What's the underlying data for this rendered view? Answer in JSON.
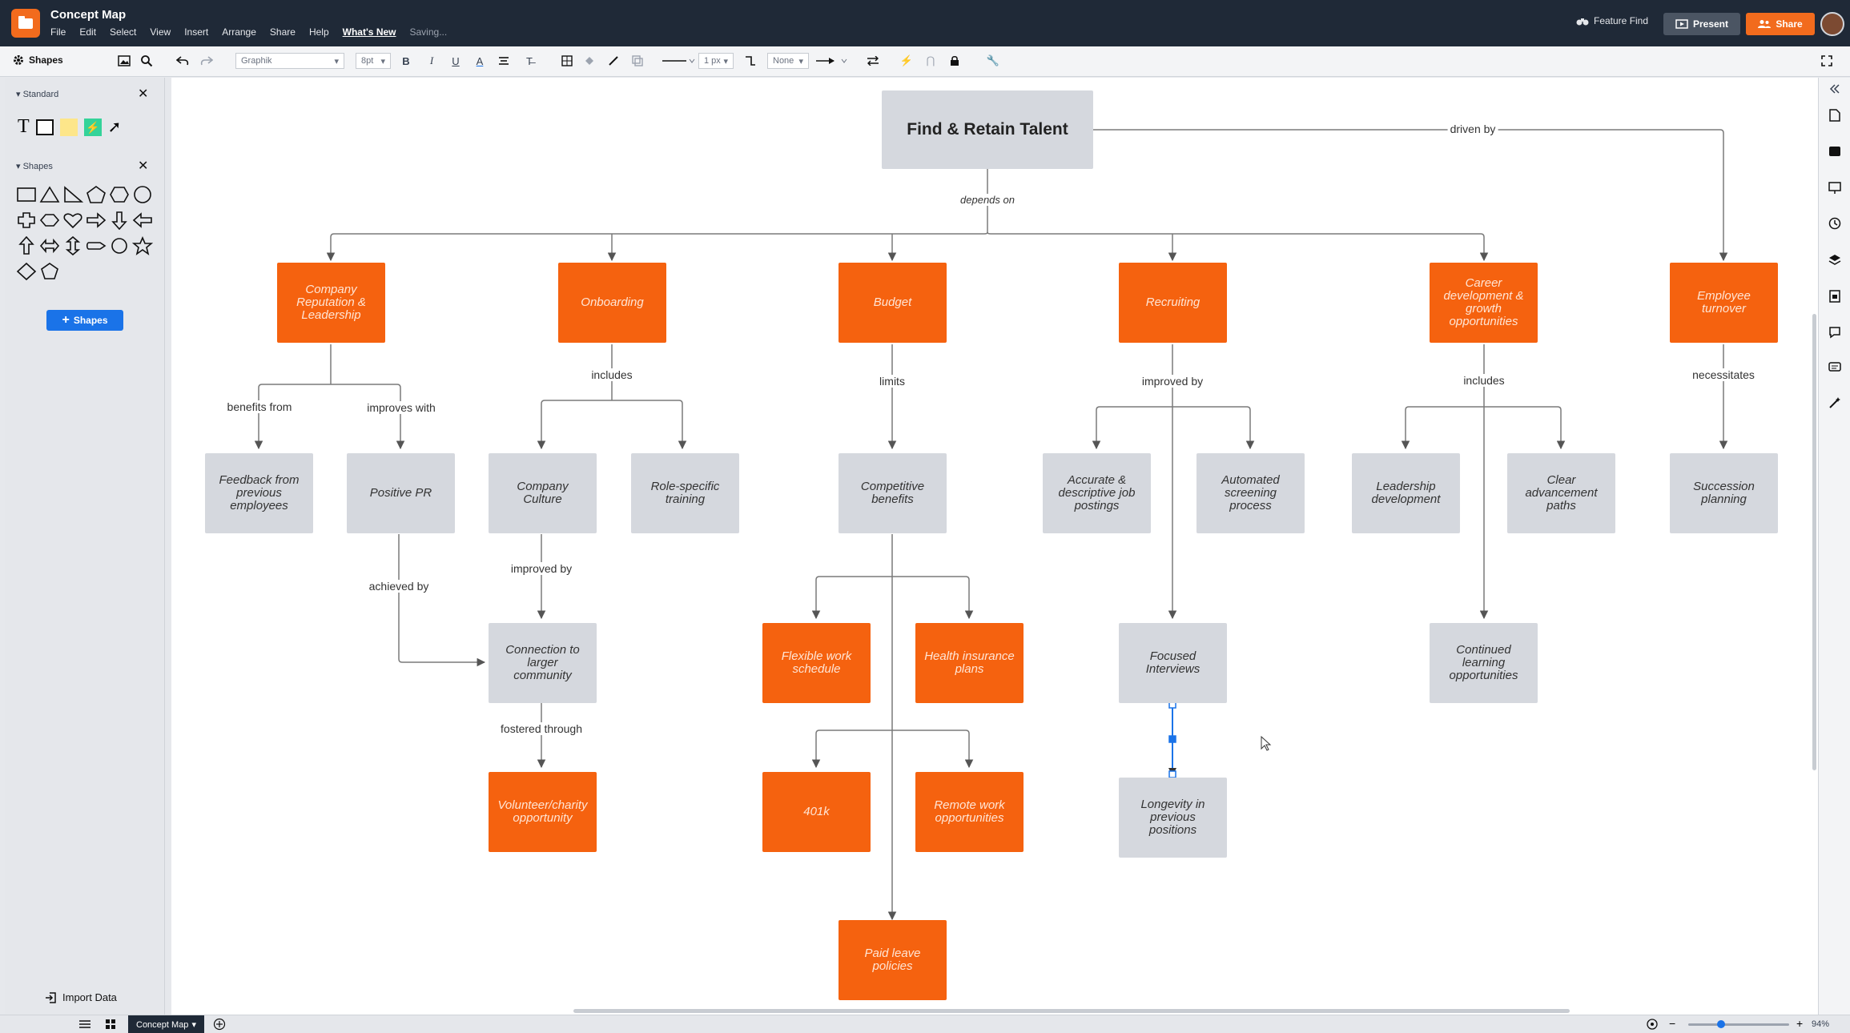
{
  "app": {
    "title": "Concept Map",
    "menus": [
      "File",
      "Edit",
      "Select",
      "View",
      "Insert",
      "Arrange",
      "Share",
      "Help",
      "What's New"
    ],
    "save_status": "Saving...",
    "feature_find": "Feature Find",
    "present": "Present",
    "share": "Share"
  },
  "toolbar": {
    "shapes_label": "Shapes",
    "font": "Graphik",
    "font_size": "8pt",
    "line_width": "1 px",
    "arrow_start": "None"
  },
  "left_panel": {
    "standard_header": "Standard",
    "shapes_header": "Shapes",
    "add_shapes_button": "Shapes",
    "import_data": "Import Data"
  },
  "diagram": {
    "root": "Find & Retain Talent",
    "root_edge_label": "depends on",
    "root_side_label": "driven by",
    "nodes": {
      "reputation": "Company Reputation & Leadership",
      "onboarding": "Onboarding",
      "budget": "Budget",
      "recruiting": "Recruiting",
      "career": "Career development & growth opportunities",
      "turnover": "Employee turnover",
      "feedback": "Feedback from previous employees",
      "positive_pr": "Positive PR",
      "culture": "Company Culture",
      "role_training": "Role-specific training",
      "competitive": "Competitive benefits",
      "accurate_postings": "Accurate & descriptive job postings",
      "screening": "Automated screening process",
      "leadership_dev": "Leadership development",
      "advancement": "Clear advancement paths",
      "succession": "Succession planning",
      "connection": "Connection to larger community",
      "flexible": "Flexible work schedule",
      "health": "Health insurance plans",
      "focused": "Focused Interviews",
      "continued": "Continued learning opportunities",
      "volunteer": "Volunteer/charity opportunity",
      "k401": "401k",
      "remote": "Remote work opportunities",
      "longevity": "Longevity in previous positions",
      "paid_leave": "Paid leave policies"
    },
    "edge_labels": {
      "benefits_from": "benefits from",
      "improves_with": "improves with",
      "onboarding_includes": "includes",
      "limits": "limits",
      "improved_by_recruiting": "improved by",
      "career_includes": "includes",
      "necessitates": "necessitates",
      "achieved_by": "achieved by",
      "improved_by_culture": "improved by",
      "fostered_through": "fostered through"
    }
  },
  "bottom": {
    "page_tab": "Concept Map",
    "zoom": "94%"
  }
}
